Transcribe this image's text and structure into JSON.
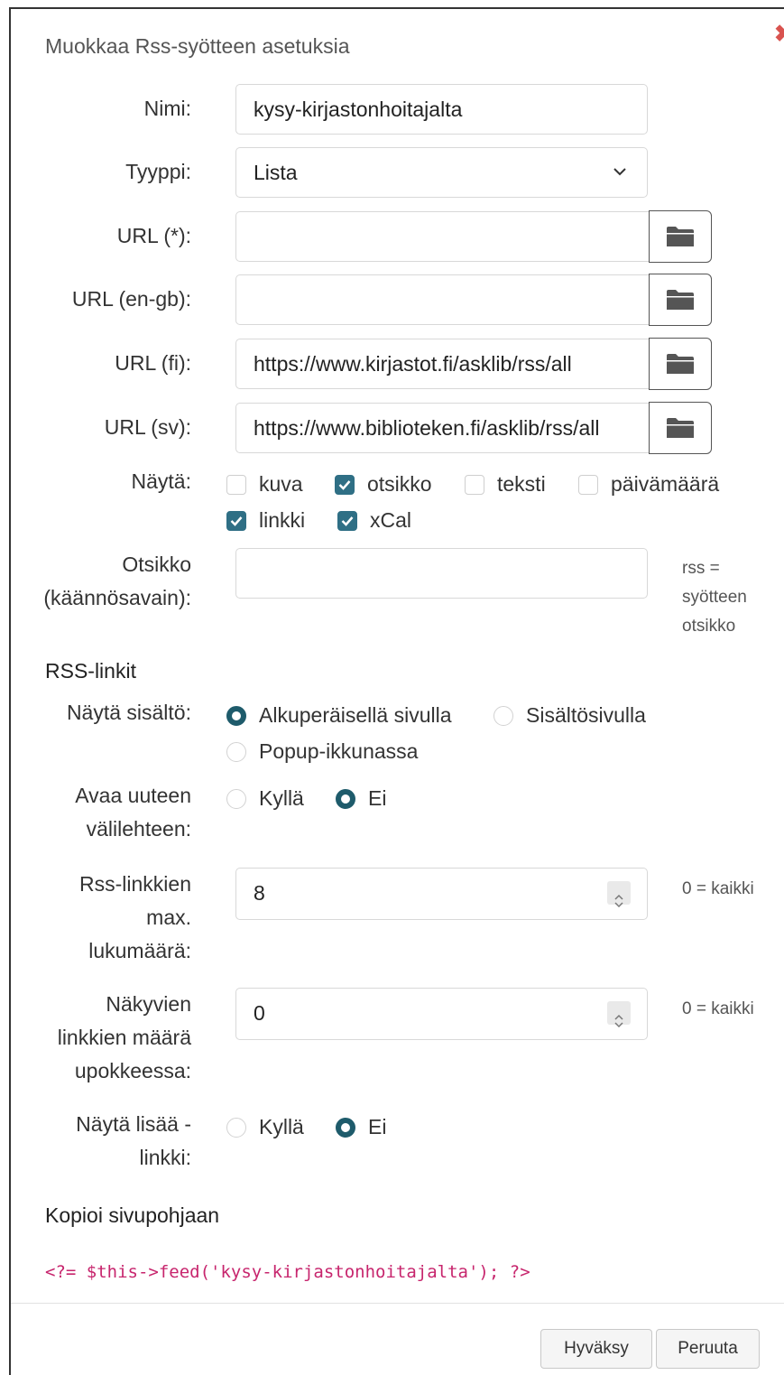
{
  "dialog": {
    "title": "Muokkaa Rss-syötteen asetuksia",
    "close_icon": "close-x-icon",
    "close_color": "#d9534f"
  },
  "form": {
    "name": {
      "label": "Nimi:",
      "value": "kysy-kirjastonhoitajalta"
    },
    "type": {
      "label": "Tyyppi:",
      "value": "Lista"
    },
    "url_default": {
      "label": "URL (*):",
      "value": ""
    },
    "url_en": {
      "label": "URL (en-gb):",
      "value": ""
    },
    "url_fi": {
      "label": "URL (fi):",
      "value": "https://www.kirjastot.fi/asklib/rss/all"
    },
    "url_sv": {
      "label": "URL (sv):",
      "value": "https://www.biblioteken.fi/asklib/rss/all"
    },
    "show": {
      "label": "Näytä:",
      "options": [
        {
          "label": "kuva",
          "checked": false
        },
        {
          "label": "otsikko",
          "checked": true
        },
        {
          "label": "teksti",
          "checked": false
        },
        {
          "label": "päivämäärä",
          "checked": false
        },
        {
          "label": "linkki",
          "checked": true
        },
        {
          "label": "xCal",
          "checked": true
        }
      ]
    },
    "heading": {
      "label_line1": "Otsikko",
      "label_line2": "(käännösavain):",
      "value": "",
      "hint_line1": "rss =",
      "hint_line2": "syötteen",
      "hint_line3": "otsikko"
    }
  },
  "rss_links": {
    "section_title": "RSS-linkit",
    "show_content": {
      "label": "Näytä sisältö:",
      "options": [
        {
          "label": "Alkuperäisellä sivulla",
          "selected": true
        },
        {
          "label": "Sisältösivulla",
          "selected": false
        },
        {
          "label": "Popup-ikkunassa",
          "selected": false
        }
      ]
    },
    "new_tab": {
      "label_line1": "Avaa uuteen",
      "label_line2": "välilehteen:",
      "options": [
        {
          "label": "Kyllä",
          "selected": false
        },
        {
          "label": "Ei",
          "selected": true
        }
      ]
    },
    "max_links": {
      "label_line1": "Rss-linkkien",
      "label_line2": "max.",
      "label_line3": "lukumäärä:",
      "value": "8",
      "hint": "0 = kaikki"
    },
    "visible_links": {
      "label_line1": "Näkyvien",
      "label_line2": "linkkien määrä",
      "label_line3": "upokkeessa:",
      "value": "0",
      "hint": "0 = kaikki"
    },
    "show_more": {
      "label_line1": "Näytä lisää -",
      "label_line2": "linkki:",
      "options": [
        {
          "label": "Kyllä",
          "selected": false
        },
        {
          "label": "Ei",
          "selected": true
        }
      ]
    }
  },
  "copy": {
    "section_title": "Kopioi sivupohjaan",
    "code": "<?= $this->feed('kysy-kirjastonhoitajalta'); ?>"
  },
  "footer": {
    "accept_label": "Hyväksy",
    "cancel_label": "Peruuta"
  },
  "colors": {
    "accent": "#1e5b6b",
    "checkbox": "#2f6f85",
    "code": "#c7256d"
  }
}
